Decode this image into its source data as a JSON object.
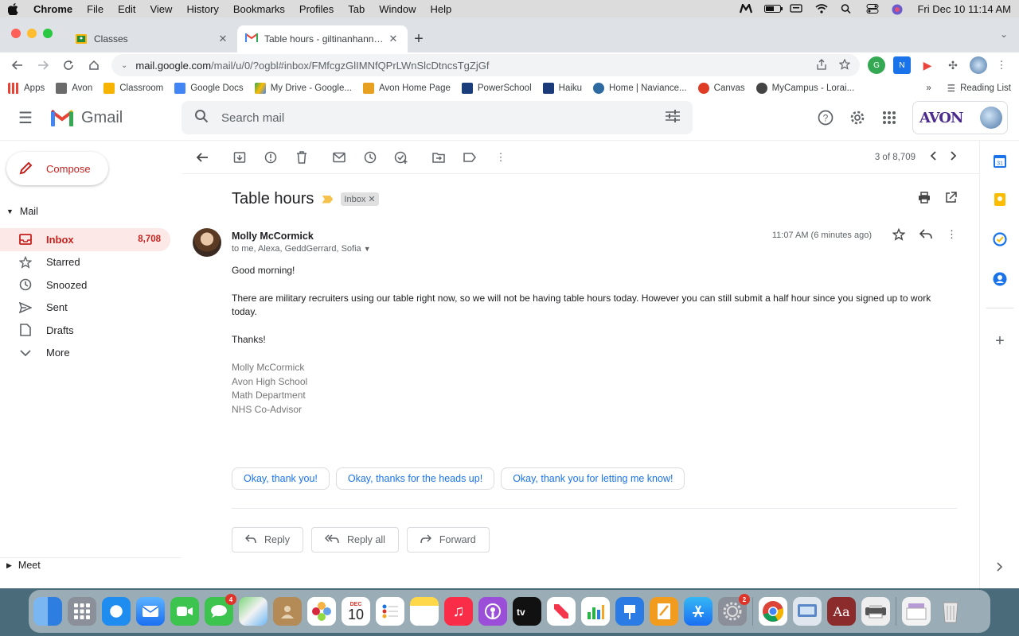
{
  "menubar": {
    "app": "Chrome",
    "items": [
      "File",
      "Edit",
      "View",
      "History",
      "Bookmarks",
      "Profiles",
      "Tab",
      "Window",
      "Help"
    ],
    "clock": "Fri Dec 10  11:14 AM"
  },
  "tabs": [
    {
      "title": "Classes",
      "active": false
    },
    {
      "title": "Table hours - giltinanhannah@",
      "active": true
    }
  ],
  "address": {
    "host": "mail.google.com",
    "path": "/mail/u/0/?ogbl#inbox/FMfcgzGlIMNfQPrLWnSlcDtncsTgZjGf"
  },
  "bookmarks": [
    {
      "label": "Apps",
      "color": "#5f6368"
    },
    {
      "label": "Avon",
      "color": "#6b6b6b"
    },
    {
      "label": "Classroom",
      "color": "#f6b400"
    },
    {
      "label": "Google Docs",
      "color": "#4285f4"
    },
    {
      "label": "My Drive - Google...",
      "color": "#34a853"
    },
    {
      "label": "Avon Home Page",
      "color": "#e8a020"
    },
    {
      "label": "PowerSchool",
      "color": "#1a3d7c"
    },
    {
      "label": "Haiku",
      "color": "#1b3a7a"
    },
    {
      "label": "Home | Naviance...",
      "color": "#2d6a9f"
    },
    {
      "label": "Canvas",
      "color": "#e03b24"
    },
    {
      "label": "MyCampus - Lorai...",
      "color": "#444"
    }
  ],
  "reading_list": "Reading List",
  "bookmarks_more": "»",
  "gmail": {
    "product": "Gmail",
    "search_placeholder": "Search mail",
    "account_logo": "AVON",
    "compose": "Compose",
    "mail_header": "Mail",
    "nav": [
      {
        "label": "Inbox",
        "count": "8,708",
        "selected": true,
        "icon": "inbox-icon"
      },
      {
        "label": "Starred",
        "count": "",
        "selected": false,
        "icon": "star-icon"
      },
      {
        "label": "Snoozed",
        "count": "",
        "selected": false,
        "icon": "clock-icon"
      },
      {
        "label": "Sent",
        "count": "",
        "selected": false,
        "icon": "send-icon"
      },
      {
        "label": "Drafts",
        "count": "",
        "selected": false,
        "icon": "draft-icon"
      },
      {
        "label": "More",
        "count": "",
        "selected": false,
        "icon": "chevron-down-icon"
      }
    ],
    "meet": "Meet",
    "pager": "3 of 8,709",
    "subject": "Table hours",
    "label": "Inbox",
    "sender": "Molly McCormick",
    "recipients": "to me, Alexa, GeddGerrard, Sofia",
    "time": "11:07 AM (6 minutes ago)",
    "body": [
      "Good morning!",
      "There are military recruiters using our table right now, so we will not be having table hours today. However you can still submit a half hour since you signed up to work today.",
      "Thanks!"
    ],
    "signature": [
      "Molly McCormick",
      "Avon High School",
      "Math Department",
      "NHS Co-Advisor"
    ],
    "smart_replies": [
      "Okay, thank you!",
      "Okay, thanks for the heads up!",
      "Okay, thank you for letting me know!"
    ],
    "actions": [
      "Reply",
      "Reply all",
      "Forward"
    ]
  },
  "dock": {
    "calendar_month": "DEC",
    "calendar_day": "10",
    "messages_badge": "4",
    "settings_badge": "2"
  }
}
